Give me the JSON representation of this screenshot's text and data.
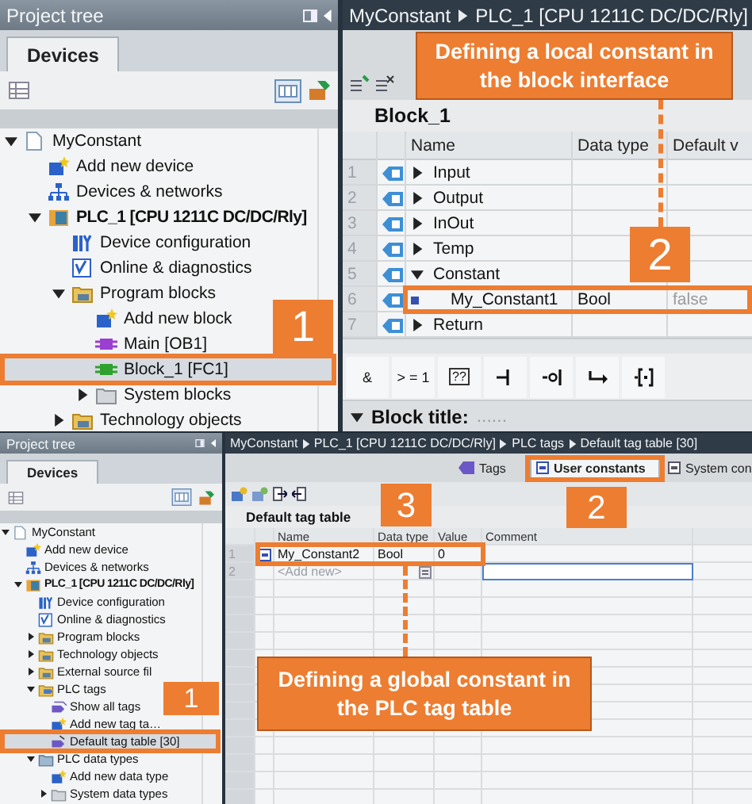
{
  "top": {
    "project_tree": {
      "title": "Project tree",
      "tab": "Devices",
      "items": [
        {
          "label": "MyConstant",
          "kind": "project",
          "expanded": true,
          "selected": false,
          "children": [
            {
              "label": "Add new device",
              "kind": "add",
              "selected": false
            },
            {
              "label": "Devices & networks",
              "kind": "network",
              "selected": false
            },
            {
              "label": "PLC_1 [CPU 1211C DC/DC/Rly]",
              "kind": "plc",
              "expanded": true,
              "selected": false,
              "children": [
                {
                  "label": "Device configuration",
                  "kind": "config",
                  "selected": false
                },
                {
                  "label": "Online & diagnostics",
                  "kind": "online",
                  "selected": false
                },
                {
                  "label": "Program blocks",
                  "kind": "folder",
                  "expanded": true,
                  "selected": false,
                  "children": [
                    {
                      "label": "Add new block",
                      "kind": "add",
                      "selected": false
                    },
                    {
                      "label": "Main [OB1]",
                      "kind": "ob",
                      "selected": false
                    },
                    {
                      "label": "Block_1 [FC1]",
                      "kind": "fc",
                      "selected": true
                    },
                    {
                      "label": "System blocks",
                      "kind": "system",
                      "expanded": false,
                      "selected": false
                    }
                  ]
                },
                {
                  "label": "Technology objects",
                  "kind": "folder",
                  "expanded": false,
                  "selected": false
                }
              ]
            }
          ]
        }
      ]
    },
    "editor": {
      "breadcrumb": [
        "MyConstant",
        "PLC_1 [CPU 1211C DC/DC/Rly]"
      ],
      "block_name": "Block_1",
      "columns": [
        "Name",
        "Data type",
        "Default v"
      ],
      "rows": [
        {
          "number": "1",
          "name": "Input",
          "expanded": false
        },
        {
          "number": "2",
          "name": "Output",
          "expanded": false
        },
        {
          "number": "3",
          "name": "InOut",
          "expanded": false
        },
        {
          "number": "4",
          "name": "Temp",
          "expanded": false
        },
        {
          "number": "5",
          "name": "Constant",
          "expanded": true
        },
        {
          "number": "6",
          "name": "My_Constant1",
          "data_type": "Bool",
          "default_value": "false"
        },
        {
          "number": "7",
          "name": "Return",
          "expanded": false
        }
      ],
      "instructions": [
        {
          "kind": "text",
          "label": "&"
        },
        {
          "kind": "text",
          "label": "> = 1"
        },
        {
          "kind": "box",
          "label": "??"
        },
        {
          "kind": "contact"
        },
        {
          "kind": "negated"
        },
        {
          "kind": "branch"
        },
        {
          "kind": "coil"
        }
      ],
      "block_title": {
        "text": "Block title:",
        "comment": "......",
        "expanded": true
      }
    },
    "annotations": [
      {
        "kind": "callout",
        "text": "Defining a local constant in the block interface"
      },
      {
        "kind": "leader"
      },
      {
        "kind": "step",
        "text": "2"
      },
      {
        "kind": "frame"
      },
      {
        "kind": "step",
        "text": "1"
      },
      {
        "kind": "frame"
      }
    ]
  },
  "bottom": {
    "project_tree": {
      "title": "Project tree",
      "tab": "Devices",
      "items": [
        {
          "label": "MyConstant",
          "kind": "project",
          "expanded": true,
          "selected": false,
          "children": [
            {
              "label": "Add new device",
              "kind": "add",
              "selected": false
            },
            {
              "label": "Devices & networks",
              "kind": "network",
              "selected": false
            },
            {
              "label": "PLC_1 [CPU 1211C DC/DC/Rly]",
              "kind": "plc",
              "expanded": true,
              "selected": false,
              "children": [
                {
                  "label": "Device configuration",
                  "kind": "config",
                  "selected": false
                },
                {
                  "label": "Online & diagnostics",
                  "kind": "online",
                  "selected": false
                },
                {
                  "label": "Program blocks",
                  "kind": "folder",
                  "expanded": false,
                  "selected": false
                },
                {
                  "label": "Technology objects",
                  "kind": "folder",
                  "expanded": false,
                  "selected": false
                },
                {
                  "label": "External source fil",
                  "kind": "folder",
                  "expanded": false,
                  "selected": false
                },
                {
                  "label": "PLC tags",
                  "kind": "tags",
                  "expanded": true,
                  "selected": false,
                  "children": [
                    {
                      "label": "Show all tags",
                      "kind": "show",
                      "selected": false
                    },
                    {
                      "label": "Add new tag ta…",
                      "kind": "add",
                      "selected": false
                    },
                    {
                      "label": "Default tag table [30]",
                      "kind": "table",
                      "selected": true
                    }
                  ]
                },
                {
                  "label": "PLC data types",
                  "kind": "types",
                  "expanded": true,
                  "selected": false,
                  "children": [
                    {
                      "label": "Add new data type",
                      "kind": "add",
                      "selected": false
                    },
                    {
                      "label": "System data types",
                      "kind": "system",
                      "expanded": false,
                      "selected": false
                    }
                  ]
                }
              ]
            }
          ]
        }
      ]
    },
    "editor": {
      "breadcrumb": [
        "MyConstant",
        "PLC_1 [CPU 1211C DC/DC/Rly]",
        "PLC tags",
        "Default tag table [30]"
      ],
      "tabs": [
        {
          "label": "Tags",
          "selected": false
        },
        {
          "label": "User constants",
          "selected": true
        },
        {
          "label": "System con",
          "selected": false
        }
      ],
      "table_name": "Default tag table",
      "columns": [
        "Name",
        "Data type",
        "Value",
        "Comment"
      ],
      "rows": [
        {
          "kind": "tag",
          "number": "1",
          "name": "My_Constant2",
          "data_type": "Bool",
          "value": "0"
        },
        {
          "kind": "add",
          "number": "2",
          "name": "<Add new>"
        }
      ]
    },
    "annotations": [
      {
        "kind": "frame"
      },
      {
        "kind": "step",
        "text": "3"
      },
      {
        "kind": "step",
        "text": "2"
      },
      {
        "kind": "frame"
      },
      {
        "kind": "leader"
      },
      {
        "kind": "step",
        "text": "1"
      },
      {
        "kind": "callout",
        "text": "Defining a global constant in the PLC tag table"
      },
      {
        "kind": "frame"
      }
    ]
  }
}
